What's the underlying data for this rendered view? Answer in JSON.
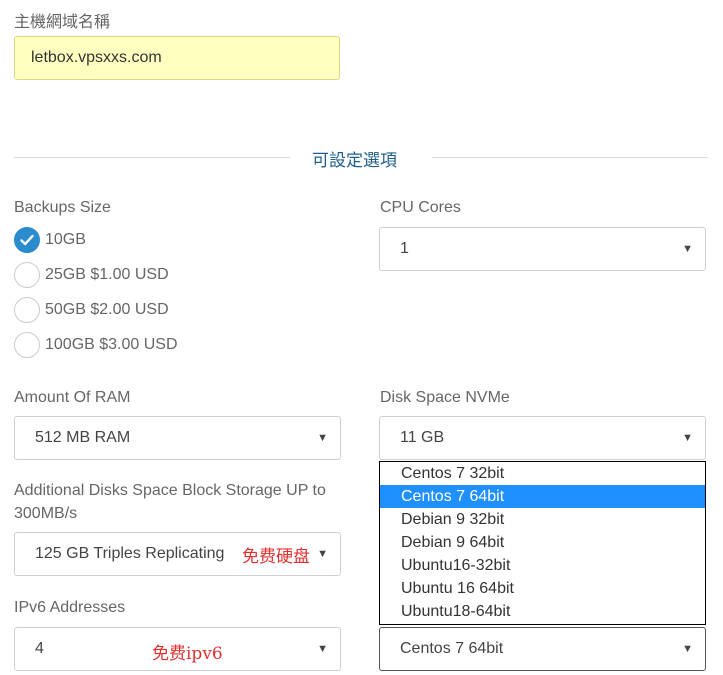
{
  "hostname": {
    "label": "主機網域名稱",
    "value": "letbox.vpsxxs.com"
  },
  "section_title": "可設定選項",
  "backups": {
    "label": "Backups Size",
    "options": [
      "10GB",
      "25GB $1.00 USD",
      "50GB $2.00 USD",
      "100GB $3.00 USD"
    ],
    "selected": "10GB"
  },
  "cpu": {
    "label": "CPU Cores",
    "value": "1"
  },
  "ram": {
    "label": "Amount Of RAM",
    "value": "512 MB RAM"
  },
  "disk": {
    "label": "Disk Space NVMe",
    "value": "11 GB"
  },
  "additional_disks": {
    "label_line1": "Additional Disks Space Block Storage UP to",
    "label_line2": "300MB/s",
    "value": "125 GB Triples Replicating",
    "note": "免费硬盘"
  },
  "ipv6": {
    "label": "IPv6 Addresses",
    "value": "4",
    "note": "免费ipv6"
  },
  "os": {
    "value": "Centos 7 64bit",
    "options": [
      "Centos 7 32bit",
      "Centos 7 64bit",
      "Debian 9 32bit",
      "Debian 9 64bit",
      "Ubuntu16-32bit",
      "Ubuntu 16 64bit",
      "Ubuntu18-64bit"
    ],
    "highlighted": "Centos 7 64bit"
  },
  "colors": {
    "accent": "#2a8ccd",
    "highlight": "#1e90ff",
    "hostname_bg": "#ffffc0",
    "note": "#e03030",
    "title": "#1f5f8b"
  }
}
